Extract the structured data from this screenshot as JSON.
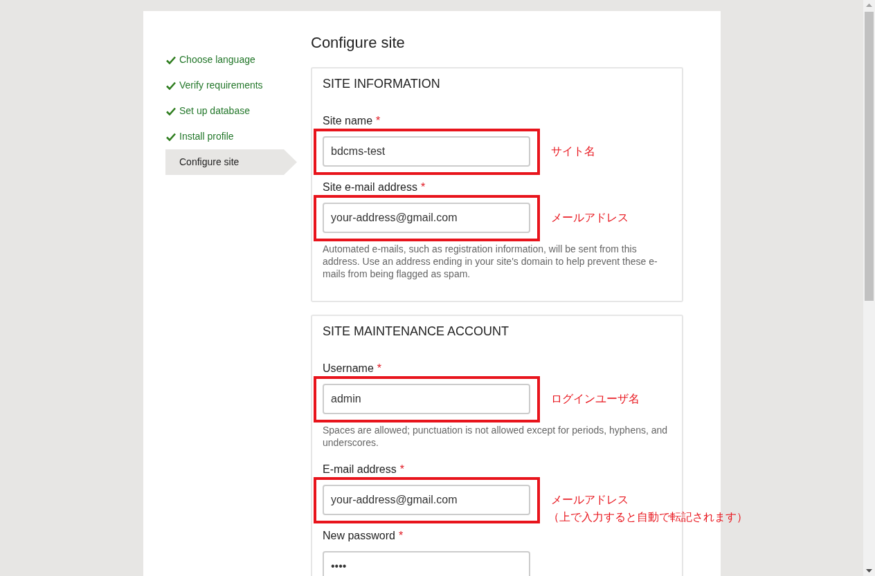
{
  "steps": [
    {
      "label": "Choose language",
      "done": true,
      "selected": false
    },
    {
      "label": "Verify requirements",
      "done": true,
      "selected": false
    },
    {
      "label": "Set up database",
      "done": true,
      "selected": false
    },
    {
      "label": "Install profile",
      "done": true,
      "selected": false
    },
    {
      "label": "Configure site",
      "done": false,
      "selected": true
    }
  ],
  "title": "Configure site",
  "sections": [
    {
      "legend": "SITE INFORMATION",
      "fields": [
        {
          "label": "Site name",
          "required_mark": "*",
          "value": "bdcms-test",
          "highlighted": true,
          "annotations": [
            "サイト名"
          ]
        },
        {
          "label": "Site e-mail address",
          "required_mark": "*",
          "value": "your-address@gmail.com",
          "highlighted": true,
          "annotations": [
            "メールアドレス"
          ],
          "description": "Automated e-mails, such as registration information, will be sent from this address. Use an address ending in your site's domain to help prevent these e-mails from being flagged as spam."
        }
      ]
    },
    {
      "legend": "SITE MAINTENANCE ACCOUNT",
      "fields": [
        {
          "label": "Username",
          "required_mark": "*",
          "value": "admin",
          "highlighted": true,
          "annotations": [
            "ログインユーザ名"
          ],
          "description": "Spaces are allowed; punctuation is not allowed except for periods, hyphens, and underscores."
        },
        {
          "label": "E-mail address",
          "required_mark": "*",
          "value": "your-address@gmail.com",
          "highlighted": true,
          "annotations": [
            "メールアドレス",
            "（上で入力すると自動で転記されます）"
          ]
        },
        {
          "label": "New password",
          "required_mark": "*",
          "value": "••••",
          "highlighted": false
        }
      ]
    }
  ]
}
